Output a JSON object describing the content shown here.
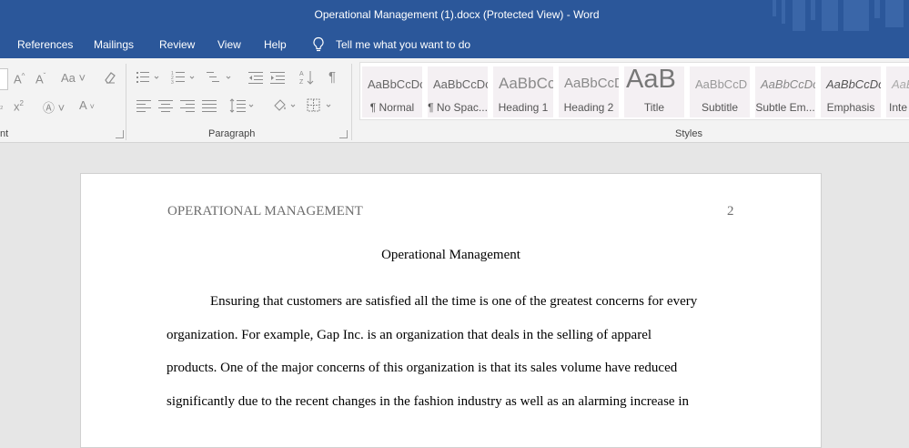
{
  "window": {
    "title": "Operational Management (1).docx (Protected View)  -  Word"
  },
  "menu": {
    "tabs": [
      "References",
      "Mailings",
      "Review",
      "View",
      "Help"
    ],
    "tell_me": "Tell me what you want to do"
  },
  "ribbon": {
    "font_group_label": "nt",
    "paragraph_group_label": "Paragraph",
    "styles_group_label": "Styles",
    "styles": [
      {
        "sample": "AaBbCcDc",
        "name": "¶ Normal"
      },
      {
        "sample": "AaBbCcDc",
        "name": "¶ No Spac..."
      },
      {
        "sample": "AaBbCc",
        "name": "Heading 1"
      },
      {
        "sample": "AaBbCcD",
        "name": "Heading 2"
      },
      {
        "sample": "AaB",
        "name": "Title"
      },
      {
        "sample": "AaBbCcD",
        "name": "Subtitle"
      },
      {
        "sample": "AaBbCcDc",
        "name": "Subtle Em..."
      },
      {
        "sample": "AaBbCcDc",
        "name": "Emphasis"
      },
      {
        "sample": "AaBbCcDc",
        "name": "Inte"
      }
    ]
  },
  "document": {
    "header_text": "OPERATIONAL MANAGEMENT",
    "page_number": "2",
    "title": "Operational Management",
    "paragraph_lines": [
      "Ensuring that customers are satisfied all the time is one of the greatest concerns for every",
      "organization. For example, Gap Inc. is an organization that deals in the selling of apparel",
      "products. One of the major concerns of this organization is that its sales volume have reduced",
      "significantly due to the recent changes in the fashion industry as well as an alarming increase in"
    ]
  },
  "colors": {
    "word_blue": "#2b579a",
    "ribbon_bg": "#f3f3f3",
    "canvas": "#e6e6e6"
  }
}
